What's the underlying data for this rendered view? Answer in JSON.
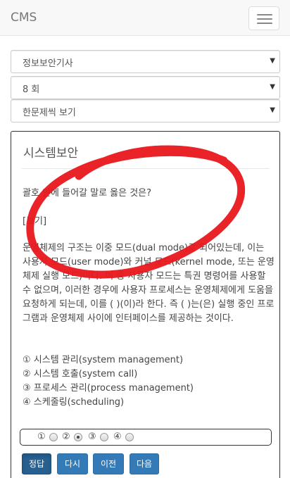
{
  "navbar": {
    "brand": "CMS",
    "menu_icon": "hamburger-menu-icon"
  },
  "selects": {
    "exam": "정보보안기사",
    "round": "8 회",
    "mode": "한문제씩 보기"
  },
  "panel": {
    "title": "시스템보안",
    "question": "괄호 안에 들어갈 말로 옳은 것은?",
    "bogi_label": "[보기]",
    "body": "운영체제의 구조는 이중 모드(dual mode)로 되어있는데, 이는 사용자 모드(user mode)와 커널 모드(kernel mode, 또는 운영체제 실행 모드)이다. 이 중 사용자 모드는 특권 명령어를 사용할 수 없으며, 이러한 경우에 사용자 프로세스는 운영체제에게 도움을 요청하게 되는데, 이를 ( )(이)라 한다. 즉 ( )는(은) 실행 중인 프로그램과 운영체제 사이에 인터페이스를 제공하는 것이다.",
    "options": [
      "① 시스템 관리(system management)",
      "② 시스템 호출(system call)",
      "③ 프로세스 관리(process management)",
      "④ 스케줄링(scheduling)"
    ]
  },
  "answer": {
    "labels": [
      "①",
      "②",
      "③",
      "④"
    ],
    "selected_index": 1
  },
  "buttons": {
    "answer": "정답",
    "retry": "다시",
    "prev": "이전",
    "next": "다음"
  },
  "colors": {
    "primary": "#337ab7",
    "annotation": "#e8171b"
  }
}
